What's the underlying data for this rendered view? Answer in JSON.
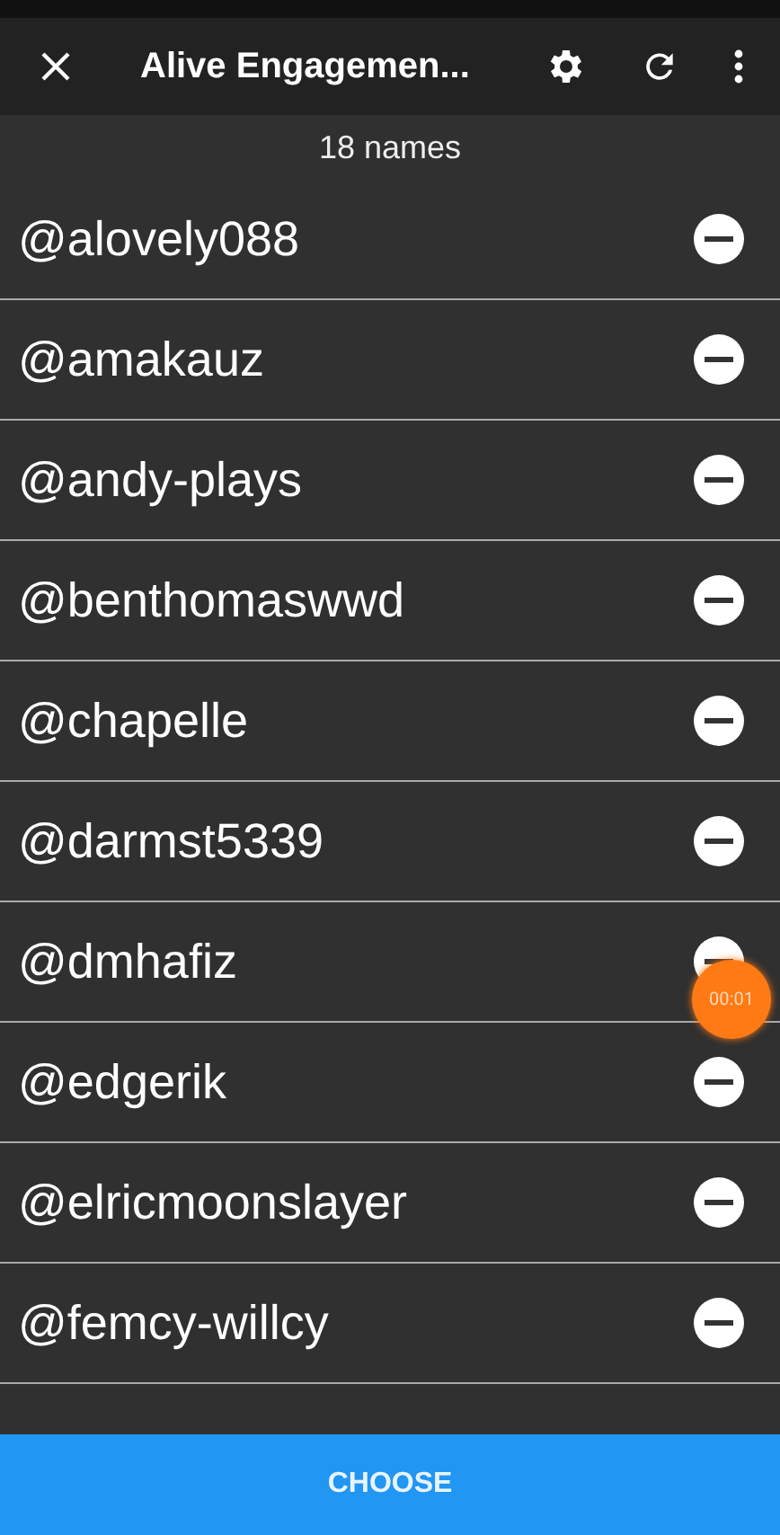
{
  "app_bar": {
    "title": "Alive Engagemen..."
  },
  "count": "18 names",
  "names": [
    {
      "name": "@alovely088"
    },
    {
      "name": "@amakauz"
    },
    {
      "name": "@andy-plays"
    },
    {
      "name": "@benthomaswwd"
    },
    {
      "name": "@chapelle"
    },
    {
      "name": "@darmst5339"
    },
    {
      "name": "@dmhafiz"
    },
    {
      "name": "@edgerik"
    },
    {
      "name": "@elricmoonslayer"
    },
    {
      "name": "@femcy-willcy"
    }
  ],
  "timer_bubble": "00:01",
  "action_button": "CHOOSE"
}
